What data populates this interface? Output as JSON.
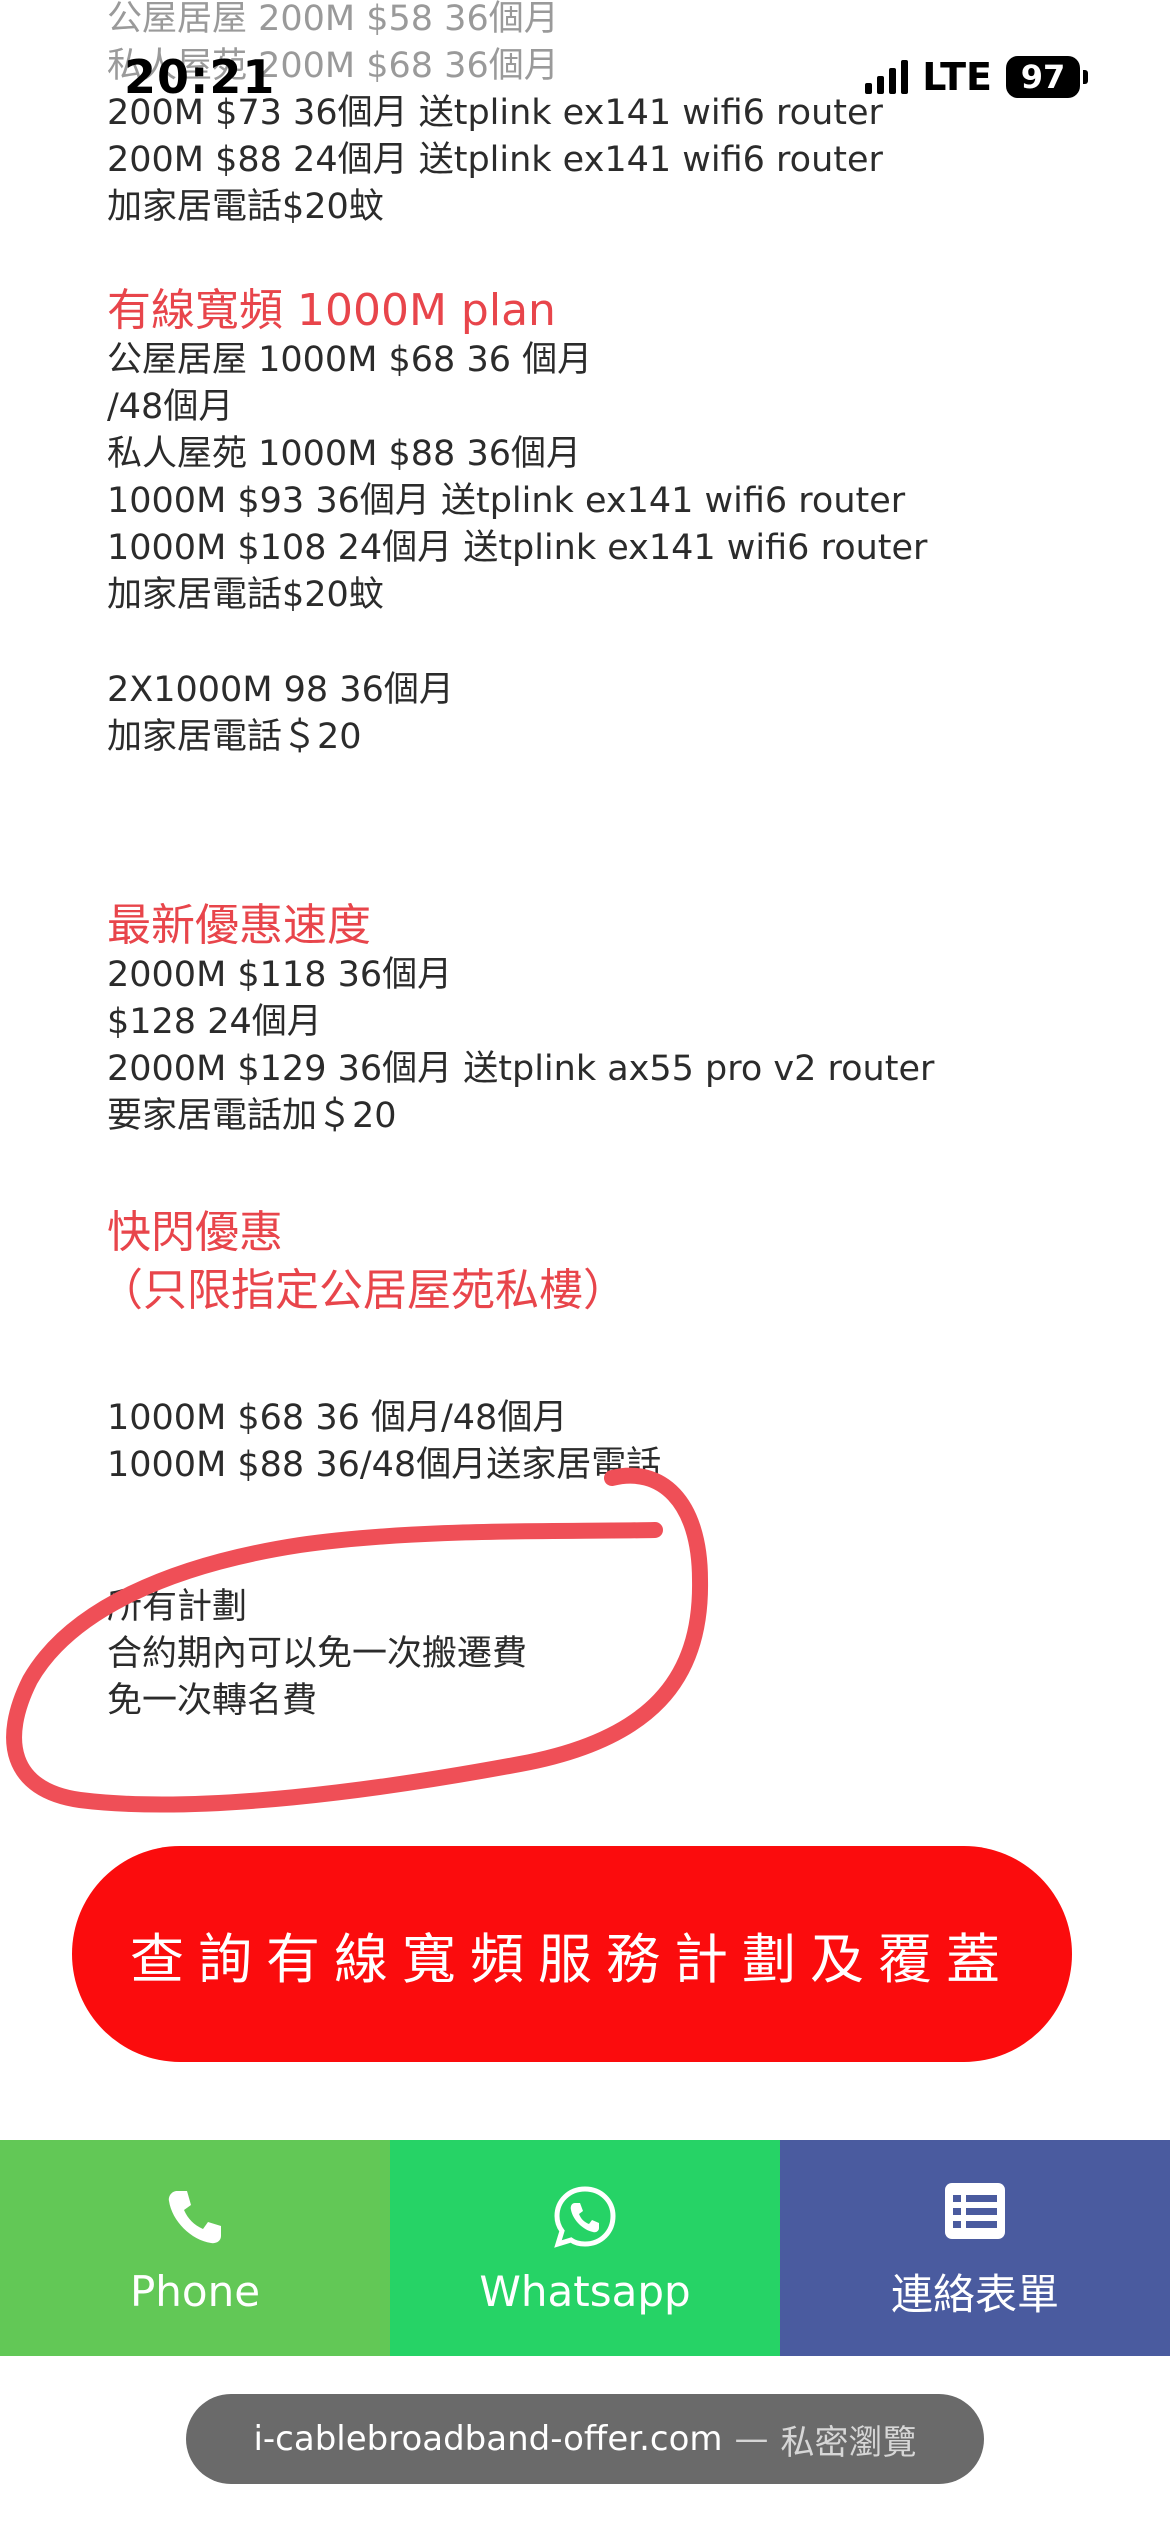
{
  "status_bar": {
    "time": "20:21",
    "network": "LTE",
    "battery": "97"
  },
  "sections": {
    "top_partial": [
      "公屋居屋 200M $58 36個月",
      "私人屋苑 200M $68 36個月",
      "200M $73 36個月 送tplink ex141 wifi6 router",
      "200M $88 24個月 送tplink ex141 wifi6 router",
      "加家居電話$20蚊"
    ],
    "plan_1000": {
      "heading": "有線寬頻 1000M plan",
      "lines": [
        "公屋居屋 1000M $68 36 個月",
        "/48個月",
        "私人屋苑 1000M $88 36個月",
        "1000M $93 36個月 送tplink ex141 wifi6 router",
        "1000M $108 24個月 送tplink ex141 wifi6 router",
        "加家居電話$20蚊"
      ]
    },
    "plan_2x1000": {
      "lines": [
        "2X1000M 98 36個月",
        "加家居電話＄20"
      ]
    },
    "latest_offer": {
      "heading": "最新優惠速度",
      "lines": [
        "2000M $118 36個月",
        "$128 24個月",
        "2000M $129 36個月 送tplink ax55 pro v2 router",
        "要家居電話加＄20"
      ]
    },
    "flash_offer": {
      "heading": "快閃優惠",
      "subheading": "（只限指定公居屋苑私樓）",
      "lines": [
        "1000M $68 36 個月/48個月",
        "1000M $88 36/48個月送家居電話"
      ]
    },
    "all_plans": {
      "lines": [
        "所有計劃",
        "合約期內可以免一次搬遷費",
        "免一次轉名費"
      ]
    }
  },
  "cta": {
    "label": "查詢有線寬頻服務計劃及覆蓋"
  },
  "contact_bar": {
    "phone": {
      "label": "Phone",
      "icon": "phone-icon"
    },
    "whatsapp": {
      "label": "Whatsapp",
      "icon": "whatsapp-icon"
    },
    "form": {
      "label": "連絡表單",
      "icon": "form-list-icon"
    }
  },
  "url_bar": {
    "domain": "i-cablebroadband-offer.com",
    "separator": "—",
    "mode": "私密瀏覽"
  },
  "colors": {
    "heading_red": "#e8454b",
    "cta_red": "#fb0c0d",
    "annotation_red": "#ef4f57",
    "phone_green": "#62c856",
    "whatsapp_green": "#26d366",
    "form_blue": "#4a5b9f"
  }
}
